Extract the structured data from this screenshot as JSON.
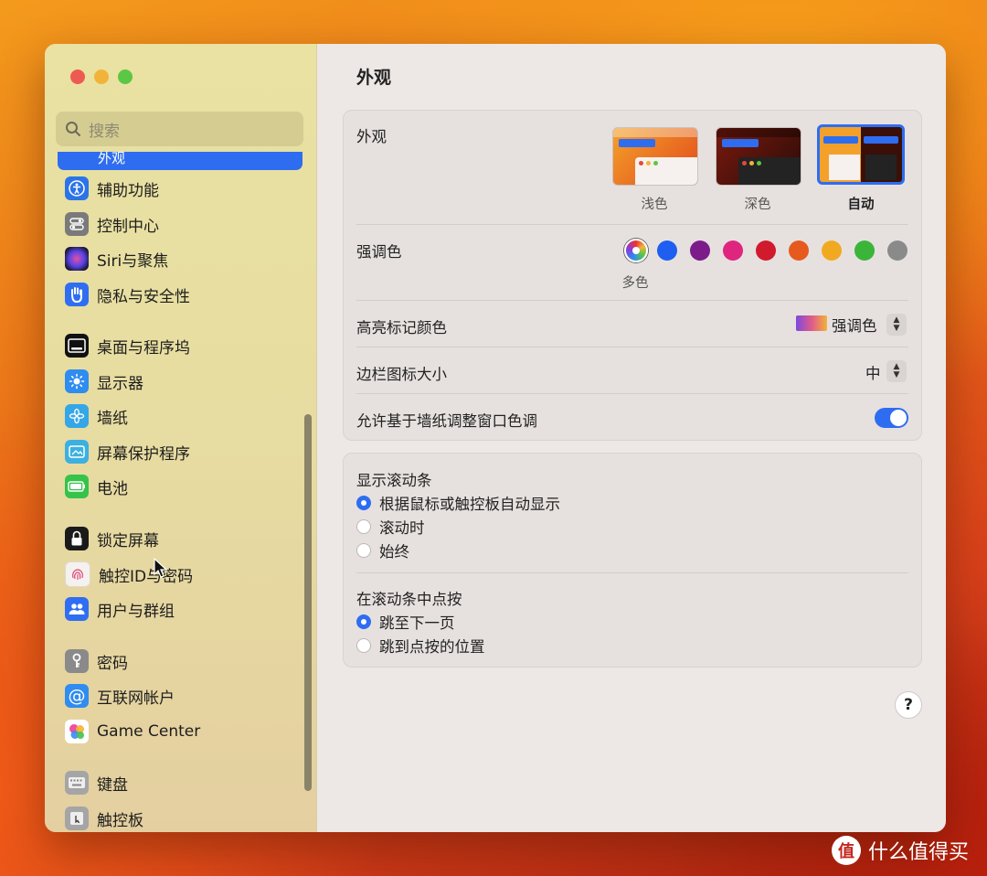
{
  "window": {
    "title": "外观",
    "search_placeholder": "搜索",
    "selected_stub_label": "外观"
  },
  "sidebar": {
    "items": [
      {
        "label": "辅助功能",
        "icon": "accessibility-icon",
        "color": "#2b74e8"
      },
      {
        "label": "控制中心",
        "icon": "control-center-icon",
        "color": "#7a7a7a"
      },
      {
        "label": "Siri与聚焦",
        "icon": "siri-icon",
        "color": "#3a2d6e"
      },
      {
        "label": "隐私与安全性",
        "icon": "hand-icon",
        "color": "#2f6ef2"
      },
      {
        "label": "桌面与程序坞",
        "icon": "dock-icon",
        "color": "#111111"
      },
      {
        "label": "显示器",
        "icon": "brightness-icon",
        "color": "#2f8cf0"
      },
      {
        "label": "墙纸",
        "icon": "wallpaper-icon",
        "color": "#35a6e6"
      },
      {
        "label": "屏幕保护程序",
        "icon": "screensaver-icon",
        "color": "#3cb0e0"
      },
      {
        "label": "电池",
        "icon": "battery-icon",
        "color": "#35c34a"
      },
      {
        "label": "锁定屏幕",
        "icon": "lock-icon",
        "color": "#1a1a1a"
      },
      {
        "label": "触控ID与密码",
        "icon": "fingerprint-icon",
        "color": "#f2f2f2"
      },
      {
        "label": "用户与群组",
        "icon": "users-icon",
        "color": "#2f6ef2"
      },
      {
        "label": "密码",
        "icon": "key-icon",
        "color": "#8a8a8a"
      },
      {
        "label": "互联网帐户",
        "icon": "at-icon",
        "color": "#2f8cf0"
      },
      {
        "label": "Game Center",
        "icon": "game-center-icon",
        "color": "#ffffff"
      },
      {
        "label": "键盘",
        "icon": "keyboard-icon",
        "color": "#9a9a9a"
      },
      {
        "label": "触控板",
        "icon": "trackpad-icon",
        "color": "#9a9a9a"
      }
    ]
  },
  "appearance": {
    "section_label": "外观",
    "options": [
      {
        "label": "浅色",
        "selected": false
      },
      {
        "label": "深色",
        "selected": false
      },
      {
        "label": "自动",
        "selected": true
      }
    ],
    "accent_label": "强调色",
    "accent_colors": [
      "multicolor",
      "#1e5ef0",
      "#7b1c8a",
      "#e0257e",
      "#d11a2e",
      "#e65a1e",
      "#f2a922",
      "#3bb43a",
      "#8a8a8a"
    ],
    "accent_selected_caption": "多色",
    "highlight_label": "高亮标记颜色",
    "highlight_value": "强调色",
    "sidebar_icon_label": "边栏图标大小",
    "sidebar_icon_value": "中",
    "tint_label": "允许基于墙纸调整窗口色调",
    "tint_on": true
  },
  "scrollbars": {
    "show_label": "显示滚动条",
    "show_options": [
      {
        "label": "根据鼠标或触控板自动显示",
        "selected": true
      },
      {
        "label": "滚动时",
        "selected": false
      },
      {
        "label": "始终",
        "selected": false
      }
    ],
    "click_label": "在滚动条中点按",
    "click_options": [
      {
        "label": "跳至下一页",
        "selected": true
      },
      {
        "label": "跳到点按的位置",
        "selected": false
      }
    ]
  },
  "help_label": "?",
  "watermark": {
    "logo": "值",
    "text": "什么值得买"
  }
}
